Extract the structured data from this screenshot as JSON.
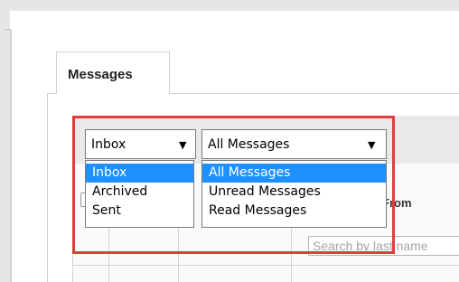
{
  "tabs": [
    {
      "label": "Messages",
      "active": true
    }
  ],
  "folder_select": {
    "value": "Inbox",
    "options": [
      {
        "label": "Inbox",
        "selected": true
      },
      {
        "label": "Archived",
        "selected": false
      },
      {
        "label": "Sent",
        "selected": false
      }
    ]
  },
  "filter_select": {
    "value": "All Messages",
    "options": [
      {
        "label": "All Messages",
        "selected": true
      },
      {
        "label": "Unread Messages",
        "selected": false
      },
      {
        "label": "Read Messages",
        "selected": false
      }
    ]
  },
  "grid": {
    "columns": [
      "From"
    ],
    "search_placeholder": "Search by last name"
  },
  "icons": {
    "dropdown_arrow": "caret-down-icon"
  },
  "colors": {
    "highlight_border": "#e53b3b",
    "selected_option_bg": "#1e90ff",
    "toolbar_bg": "#e9e9e9"
  }
}
